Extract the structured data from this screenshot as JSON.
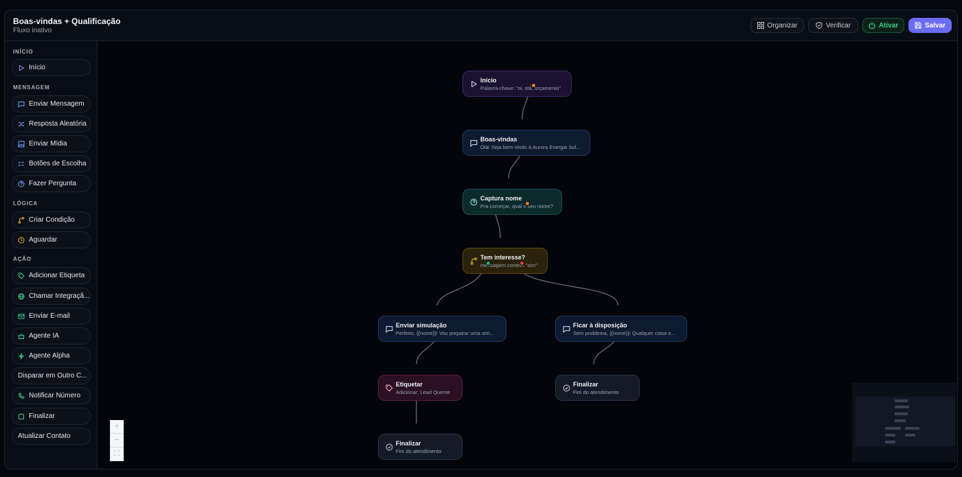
{
  "header": {
    "title": "Boas-vindas + Qualificação",
    "status": "Fluxo inativo",
    "buttons": {
      "organizar": "Organizar",
      "verificar": "Verificar",
      "ativar": "Ativar",
      "salvar": "Salvar"
    }
  },
  "sidebar": {
    "sections": {
      "inicio": "INÍCIO",
      "mensagem": "MENSAGEM",
      "logica": "LÓGICA",
      "acao": "AÇÃO"
    },
    "items": {
      "inicio": "Início",
      "enviar_mensagem": "Enviar Mensagem",
      "resposta_aleatoria": "Resposta Aleatória",
      "enviar_midia": "Enviar Mídia",
      "botoes_escolha": "Botões de Escolha",
      "fazer_pergunta": "Fazer Pergunta",
      "criar_condicao": "Criar Condição",
      "aguardar": "Aguardar",
      "adicionar_etiqueta": "Adicionar Etiqueta",
      "chamar_integracao": "Chamar Integraçã...",
      "enviar_email": "Enviar E-mail",
      "agente_ia": "Agente IA",
      "agente_alpha": "Agente Alpha",
      "disparar_outro": "Disparar em Outro C...",
      "notificar_numero": "Notificar Número",
      "finalizar": "Finalizar",
      "atualizar_contato": "Atualizar Contato"
    }
  },
  "nodes": {
    "inicio": {
      "title": "Início",
      "subtitle": "Palavra-chave: \"oi, olá, orçamento\""
    },
    "boas_vindas": {
      "title": "Boas-vindas",
      "subtitle": "Olá! Seja bem-vindo à Aurora Energia Sol..."
    },
    "captura_nome": {
      "title": "Captura nome",
      "subtitle": "Pra começar, qual o seu nome?"
    },
    "tem_interesse": {
      "title": "Tem interesse?",
      "subtitle": "mensagem contém \"sim\""
    },
    "enviar_simulacao": {
      "title": "Enviar simulação",
      "subtitle": "Perfeito, {{nome}}! Vou preparar uma sim..."
    },
    "ficar_disposicao": {
      "title": "Ficar à disposição",
      "subtitle": "Sem problema, {{nome}}! Qualquer coisa e..."
    },
    "etiquetar": {
      "title": "Etiquetar",
      "subtitle": "Adicionar: Lead Quente"
    },
    "finalizar_1": {
      "title": "Finalizar",
      "subtitle": "Fim do atendimento"
    },
    "finalizar_2": {
      "title": "Finalizar",
      "subtitle": "Fim do atendimento"
    }
  },
  "zoom_controls": {
    "zoom_in": "+",
    "zoom_out": "−",
    "fit": "⛶"
  },
  "colors": {
    "accent": "#6a6cf2",
    "active_green": "#3fd18a",
    "handle_orange": "#e07a2e",
    "handle_green": "#2fb36b",
    "handle_red": "#e0453e"
  }
}
